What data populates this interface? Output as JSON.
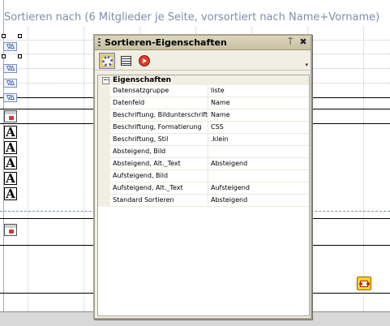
{
  "report_header": {
    "text": "Sortieren nach (6 Mitglieder je Seite, vorsortiert nach Name+Vorname)"
  },
  "left_controls": {
    "sort_icon_text": "∇∆",
    "text_icon_letter": "A"
  },
  "properties_window": {
    "title": "Sortieren-Eigenschaften",
    "pin_glyph": "⍑",
    "close_glyph": "✖",
    "more_glyph": "▾",
    "toolbar": {
      "properties_tool": "gear-icon",
      "list_tool": "list-icon",
      "events_tool": "event-icon"
    },
    "category": {
      "toggle": "−",
      "label": "Eigenschaften"
    },
    "rows": [
      {
        "name": "Datensatzgruppe",
        "value": "liste"
      },
      {
        "name": "Datenfeld",
        "value": "Name"
      },
      {
        "name": "Beschriftung, Bildunterschrift",
        "value": "Name"
      },
      {
        "name": "Beschriftung, Formatierung",
        "value": "CSS"
      },
      {
        "name": "Beschriftung, Stil",
        "value": ".klein"
      },
      {
        "name": "Absteigend, Bild",
        "value": ""
      },
      {
        "name": "Absteigend, Alt._Text",
        "value": "Absteigend"
      },
      {
        "name": "Aufsteigend, Bild",
        "value": ""
      },
      {
        "name": "Aufsteigend, Alt._Text",
        "value": "Aufsteigend"
      },
      {
        "name": "Standard Sortieren",
        "value": "Absteigend"
      }
    ]
  },
  "colors": {
    "header_text": "#7e8ea8",
    "guide_line": "#4fd1d9",
    "title_bar": "#d4ceb4",
    "active_tool": "#e8c976"
  }
}
